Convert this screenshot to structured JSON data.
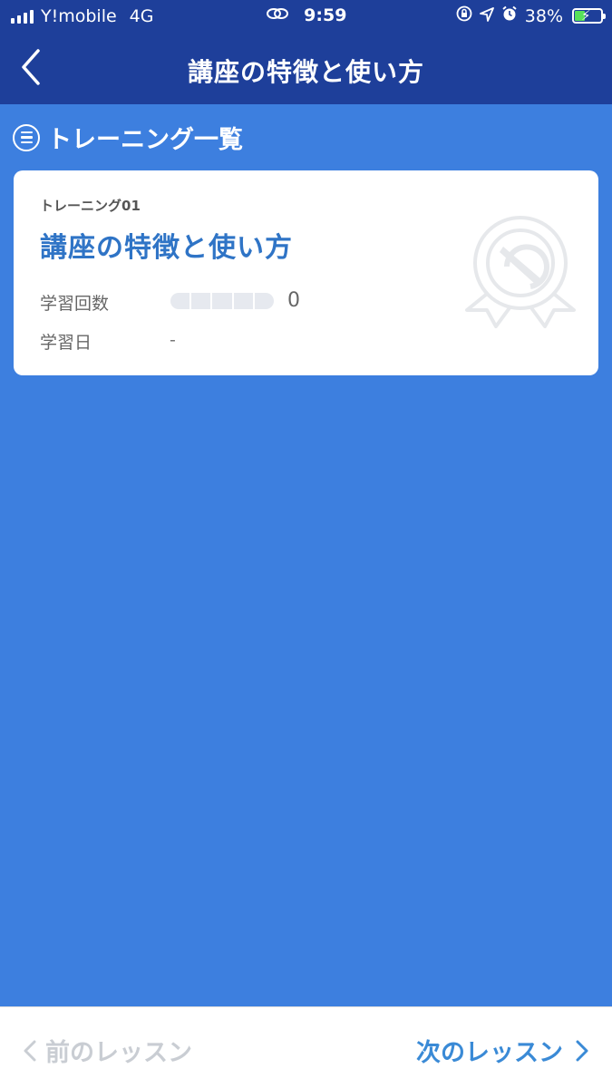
{
  "statusbar": {
    "carrier": "Y!mobile",
    "network": "4G",
    "time": "9:59",
    "battery": "38%",
    "battery_level": 0.38
  },
  "navbar": {
    "title": "講座の特徴と使い方"
  },
  "section": {
    "title": "トレーニング一覧"
  },
  "card": {
    "subtitle": "トレーニング01",
    "title": "講座の特徴と使い方",
    "study_count_label": "学習回数",
    "study_count_value": "0",
    "study_progress_segments": 5,
    "study_progress_filled": 0,
    "study_date_label": "学習日",
    "study_date_value": "-"
  },
  "bottombar": {
    "prev_label": "前のレッスン",
    "next_label": "次のレッスン"
  },
  "colors": {
    "navbar": "#1e3f9a",
    "background": "#3d7fdf",
    "card_title": "#2f74c6",
    "next_button": "#3a8ad6",
    "prev_button_disabled": "#c9cdd3"
  }
}
